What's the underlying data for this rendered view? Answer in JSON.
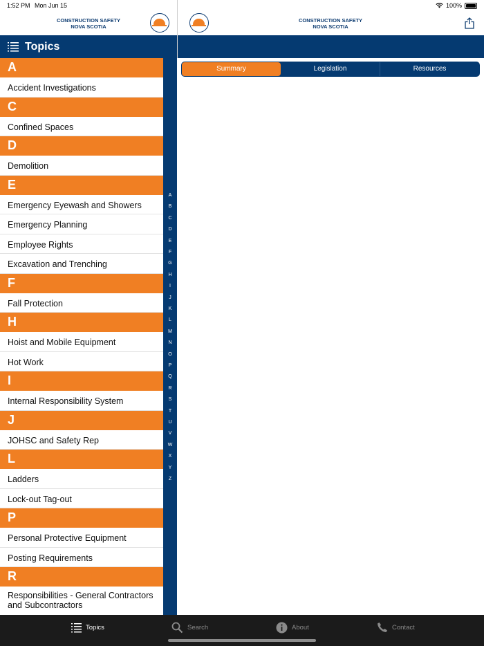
{
  "status": {
    "time": "1:52 PM",
    "date": "Mon Jun 15",
    "battery": "100%"
  },
  "brand": {
    "line1": "CONSTRUCTION SAFETY",
    "line2": "NOVA SCOTIA"
  },
  "sidebar": {
    "title": "Topics"
  },
  "sections": [
    {
      "letter": "A",
      "items": [
        "Accident Investigations"
      ]
    },
    {
      "letter": "C",
      "items": [
        "Confined Spaces"
      ]
    },
    {
      "letter": "D",
      "items": [
        "Demolition"
      ]
    },
    {
      "letter": "E",
      "items": [
        "Emergency Eyewash and Showers",
        "Emergency Planning",
        "Employee Rights",
        "Excavation and Trenching"
      ]
    },
    {
      "letter": "F",
      "items": [
        "Fall Protection"
      ]
    },
    {
      "letter": "H",
      "items": [
        "Hoist and Mobile Equipment",
        "Hot Work"
      ]
    },
    {
      "letter": "I",
      "items": [
        "Internal Responsibility System"
      ]
    },
    {
      "letter": "J",
      "items": [
        "JOHSC and Safety Rep"
      ]
    },
    {
      "letter": "L",
      "items": [
        "Ladders",
        "Lock-out Tag-out"
      ]
    },
    {
      "letter": "P",
      "items": [
        "Personal Protective Equipment",
        "Posting Requirements"
      ]
    },
    {
      "letter": "R",
      "items": [
        "Responsibilities - General Contractors and Subcontractors"
      ]
    }
  ],
  "index_letters": [
    "A",
    "B",
    "C",
    "D",
    "E",
    "F",
    "G",
    "H",
    "I",
    "J",
    "K",
    "L",
    "M",
    "N",
    "O",
    "P",
    "Q",
    "R",
    "S",
    "T",
    "U",
    "V",
    "W",
    "X",
    "Y",
    "Z"
  ],
  "segments": [
    "Summary",
    "Legislation",
    "Resources"
  ],
  "tabs": [
    {
      "label": "Topics",
      "icon": "list-icon",
      "active": true
    },
    {
      "label": "Search",
      "icon": "search-icon",
      "active": false
    },
    {
      "label": "About",
      "icon": "info-icon",
      "active": false
    },
    {
      "label": "Contact",
      "icon": "phone-icon",
      "active": false
    }
  ],
  "colors": {
    "navy": "#053a71",
    "orange": "#f07f23",
    "tabbar": "#1b1b1b"
  }
}
